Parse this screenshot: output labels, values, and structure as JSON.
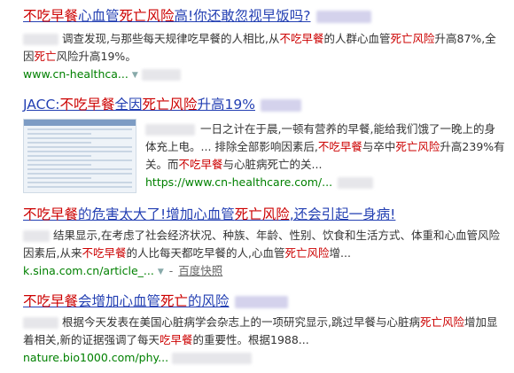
{
  "results": [
    {
      "title": [
        "不吃早餐",
        "心血管",
        "死亡风险",
        "高!你还敢忽视早饭吗?"
      ],
      "snippet": [
        "调查发现,与那些每天规律吃早餐的人相比,从",
        "不吃早餐",
        "的人群心血管",
        "死亡风险",
        "升高87%,全因",
        "死亡",
        "风险升高19%。"
      ],
      "url": "www.cn-healthca..."
    },
    {
      "title": [
        "JACC:",
        "不吃早餐",
        "全因",
        "死亡风险",
        "升高19%"
      ],
      "snippet": [
        "一日之计在于晨,一顿有营养的早餐,能给我们饿了一晚上的身体充上电。... 排除全部影响因素后,",
        "不吃早餐",
        "与卒中",
        "死亡风险",
        "升高239%有关。而",
        "不吃早餐",
        "与心脏病死亡的关..."
      ],
      "url": "https://www.cn-healthcare.com/..."
    },
    {
      "title": [
        "不吃早餐",
        "的危害太大了!增加心血管",
        "死亡风险",
        ",还会引起一身病!"
      ],
      "snippet": [
        "结果显示,在考虑了社会经济状况、种族、年龄、性别、饮食和生活方式、体重和心血管风险因素后,从来",
        "不吃早餐",
        "的人比每天都吃早餐的人,心血管",
        "死亡风险",
        "增..."
      ],
      "url": "k.sina.com.cn/article_...",
      "snapshot": "百度快照"
    },
    {
      "title": [
        "不吃早餐",
        "会增加心血管",
        "死亡",
        "的风险"
      ],
      "snippet": [
        "根据今天发表在美国心脏病学会杂志上的一项研究显示,跳过早餐与心脏病",
        "死亡风险",
        "增加显着相关,新的证据强调了每天",
        "吃早餐",
        "的重要性。根据1988..."
      ],
      "url": "nature.bio1000.com/phy..."
    }
  ],
  "colors": {
    "title": "#2440b3",
    "highlight": "#cc0000",
    "url": "#008000"
  },
  "icons": {
    "url_dropdown": "triangle-down-icon"
  }
}
